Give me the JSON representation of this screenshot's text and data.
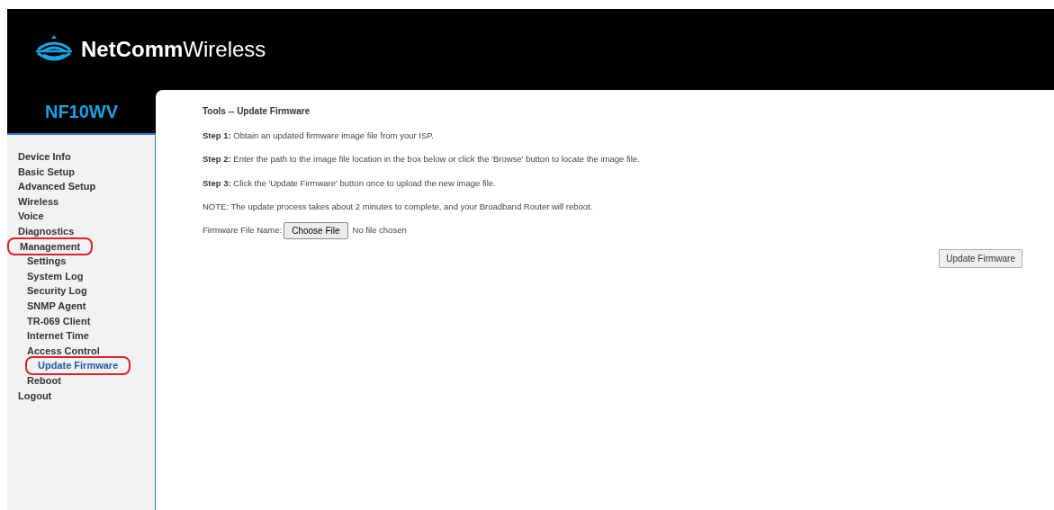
{
  "brand": {
    "name_bold": "NetComm",
    "name_light": "Wireless"
  },
  "model": "NF10WV",
  "nav": [
    {
      "label": "Device Info",
      "selected": false,
      "circled": false
    },
    {
      "label": "Basic Setup",
      "selected": false,
      "circled": false
    },
    {
      "label": "Advanced Setup",
      "selected": false,
      "circled": false
    },
    {
      "label": "Wireless",
      "selected": false,
      "circled": false
    },
    {
      "label": "Voice",
      "selected": false,
      "circled": false
    },
    {
      "label": "Diagnostics",
      "selected": false,
      "circled": false
    },
    {
      "label": "Management",
      "selected": false,
      "circled": true,
      "children": [
        {
          "label": "Settings",
          "selected": false,
          "circled": false
        },
        {
          "label": "System Log",
          "selected": false,
          "circled": false
        },
        {
          "label": "Security Log",
          "selected": false,
          "circled": false
        },
        {
          "label": "SNMP Agent",
          "selected": false,
          "circled": false
        },
        {
          "label": "TR-069 Client",
          "selected": false,
          "circled": false
        },
        {
          "label": "Internet Time",
          "selected": false,
          "circled": false
        },
        {
          "label": "Access Control",
          "selected": false,
          "circled": false
        },
        {
          "label": "Update Firmware",
          "selected": true,
          "circled": true
        },
        {
          "label": "Reboot",
          "selected": false,
          "circled": false
        }
      ]
    },
    {
      "label": "Logout",
      "selected": false,
      "circled": false
    }
  ],
  "content": {
    "title": "Tools -- Update Firmware",
    "steps": [
      {
        "label": "Step 1:",
        "text": "Obtain an updated firmware image file from your ISP."
      },
      {
        "label": "Step 2:",
        "text": "Enter the path to the image file location in the box below or click the 'Browse' button to locate the image file."
      },
      {
        "label": "Step 3:",
        "text": "Click the 'Update Firmware' button once to upload the new image file."
      }
    ],
    "note": "NOTE: The update process takes about 2 minutes to complete, and your Broadband Router will reboot.",
    "file_field": {
      "label": "Firmware File Name:",
      "button": "Choose File",
      "value": "No file chosen"
    },
    "submit": "Update Firmware"
  }
}
